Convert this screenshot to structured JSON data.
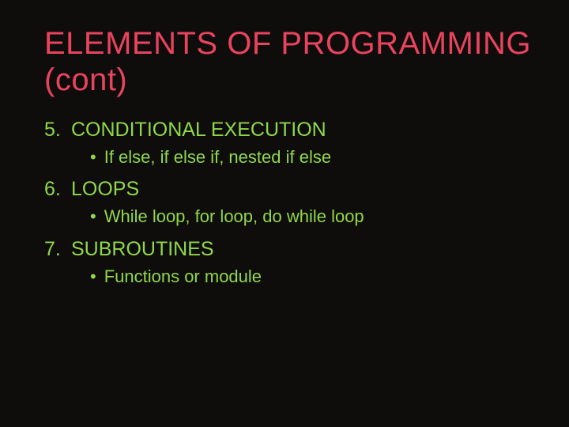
{
  "title": "ELEMENTS OF PROGRAMMING (cont)",
  "items": [
    {
      "number": "5.",
      "heading": "CONDITIONAL EXECUTION",
      "sub": "If else, if else if, nested if else"
    },
    {
      "number": "6.",
      "heading": "LOOPS",
      "sub": "While loop, for loop, do while loop"
    },
    {
      "number": "7.",
      "heading": "SUBROUTINES",
      "sub": "Functions or module"
    }
  ],
  "bullet": "•"
}
